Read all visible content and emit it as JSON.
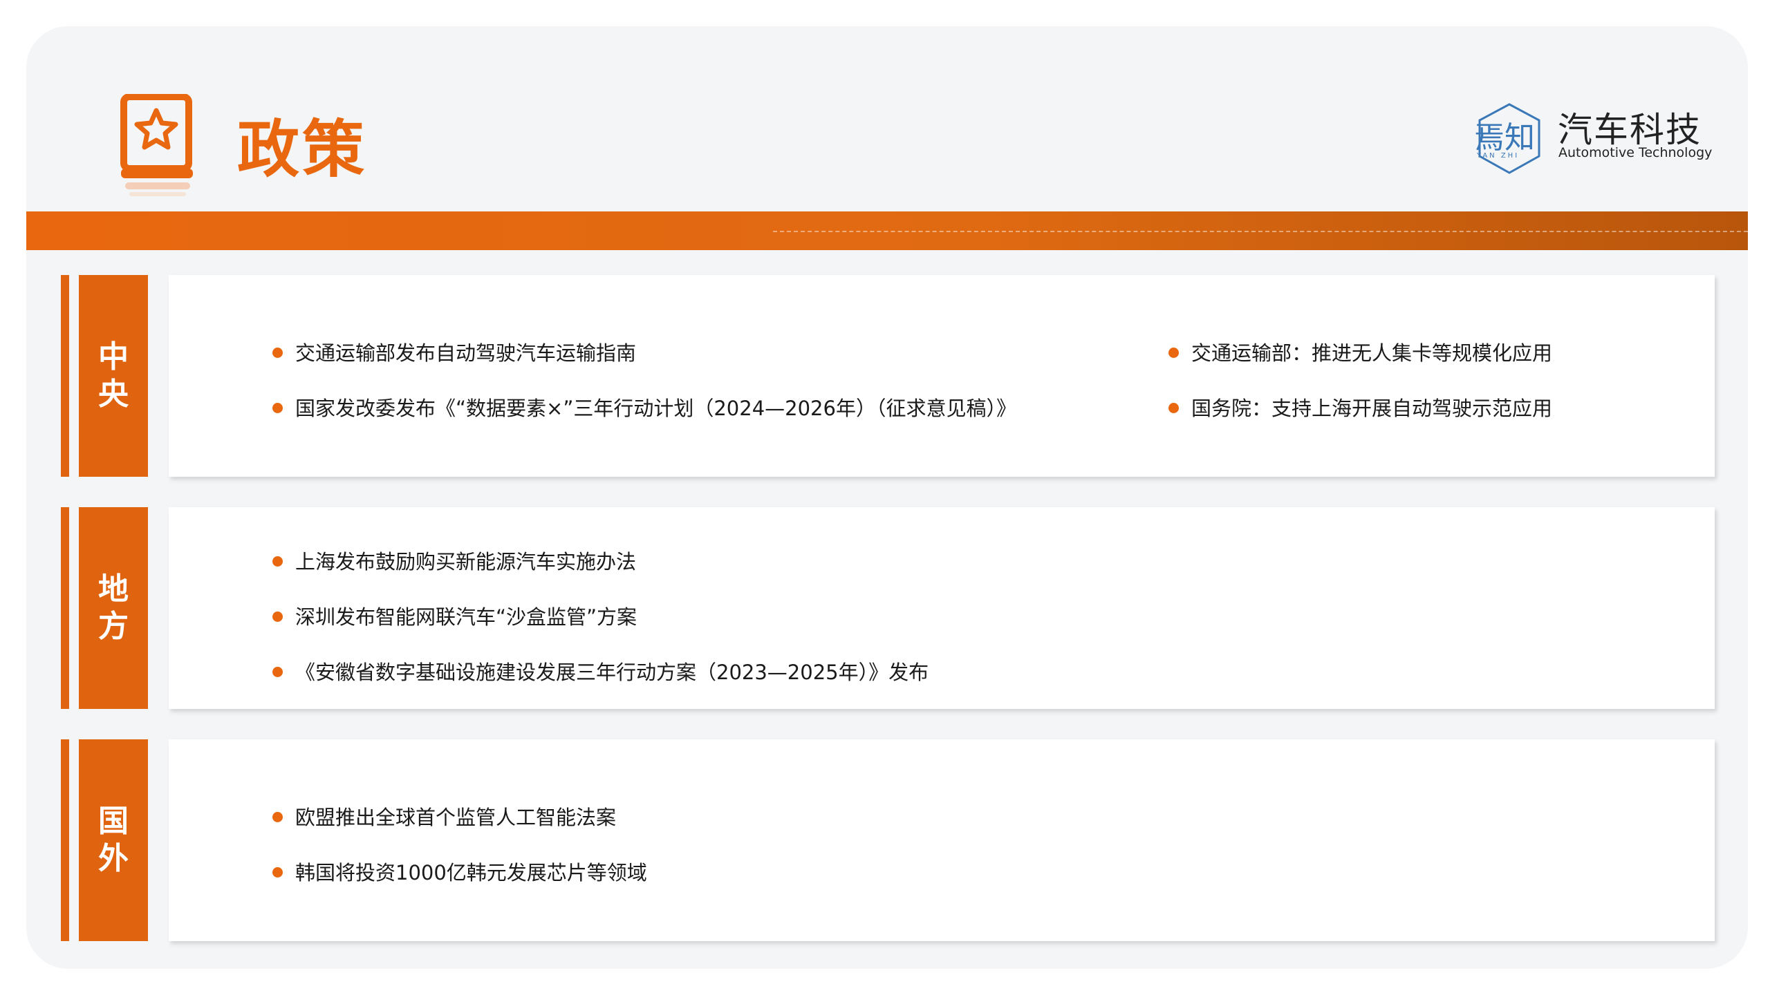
{
  "header": {
    "title": "政策",
    "logo": {
      "mark_text": "焉知",
      "mark_sub": "YAN ZHI",
      "name_cn": "汽车科技",
      "name_en": "Automotive Technology"
    }
  },
  "sections": [
    {
      "label": "中央",
      "items": [
        "交通运输部发布自动驾驶汽车运输指南",
        "国家发改委发布《“数据要素×”三年行动计划（2024—2026年）（征求意见稿）》",
        "交通运输部：推进无人集卡等规模化应用",
        "国务院：支持上海开展自动驾驶示范应用"
      ]
    },
    {
      "label": "地方",
      "items": [
        "上海发布鼓励购买新能源汽车实施办法",
        "深圳发布智能网联汽车“沙盒监管”方案",
        "《安徽省数字基础设施建设发展三年行动方案（2023—2025年）》发布"
      ]
    },
    {
      "label": "国外",
      "items": [
        "欧盟推出全球首个监管人工智能法案",
        "韩国将投资1000亿韩元发展芯片等领域"
      ]
    }
  ],
  "colors": {
    "accent": "#e8670f",
    "band_end": "#b8560c",
    "logo_blue": "#3a78b8"
  },
  "icons": [
    "star-book-icon",
    "yanzhi-logo-icon",
    "bullet-dot-icon"
  ]
}
